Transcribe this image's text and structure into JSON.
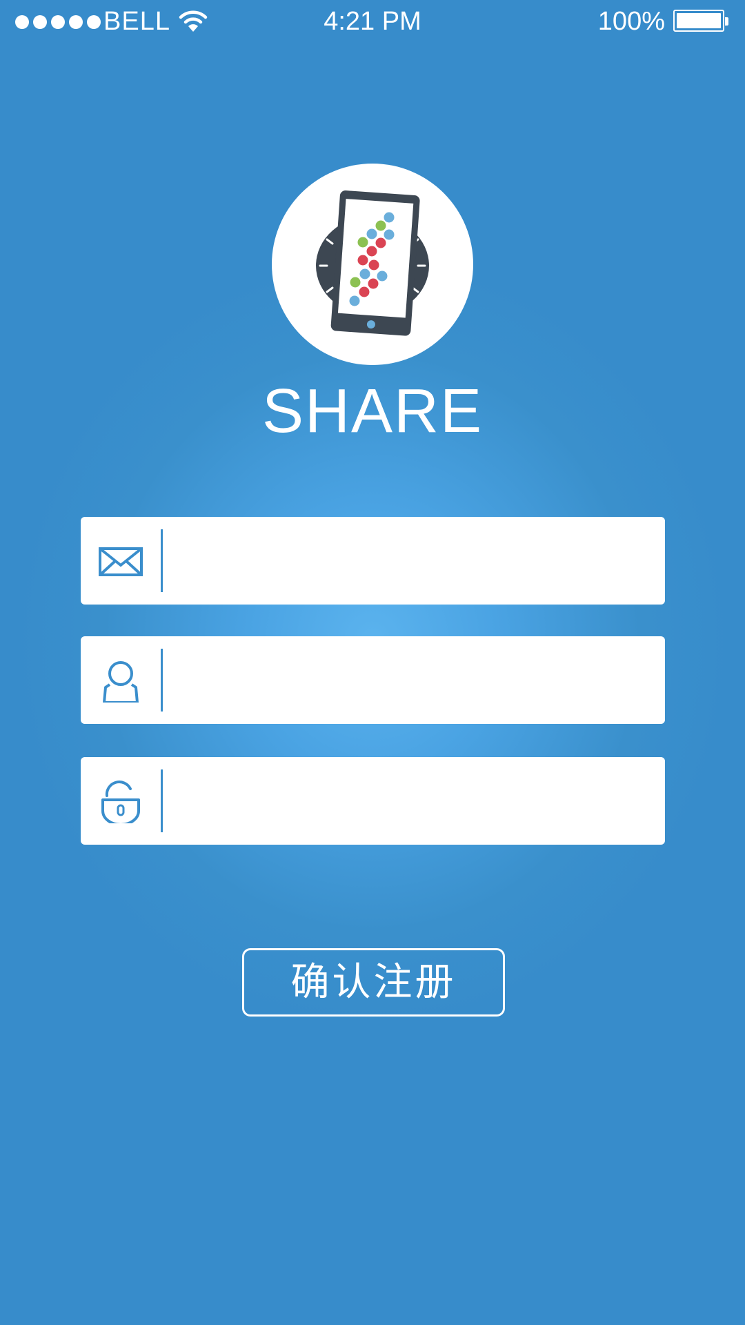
{
  "status_bar": {
    "carrier": "BELL",
    "time": "4:21 PM",
    "battery_percent": "100%",
    "signal_bars": 5,
    "battery_level": 1.0
  },
  "app": {
    "name": "SHARE"
  },
  "form": {
    "email": {
      "value": "",
      "placeholder": "",
      "icon": "envelope-icon"
    },
    "username": {
      "value": "",
      "placeholder": "",
      "icon": "user-icon"
    },
    "password": {
      "value": "",
      "placeholder": "",
      "icon": "unlock-icon"
    },
    "confirm_label": "确认注册"
  },
  "colors": {
    "accent": "#3a8ecc",
    "background": "#378ccb",
    "background_glow": "#5bb3ee",
    "logo_dark": "#3d4752",
    "dot_blue": "#6aaedb",
    "dot_green": "#8cc152",
    "dot_red": "#da4453"
  }
}
